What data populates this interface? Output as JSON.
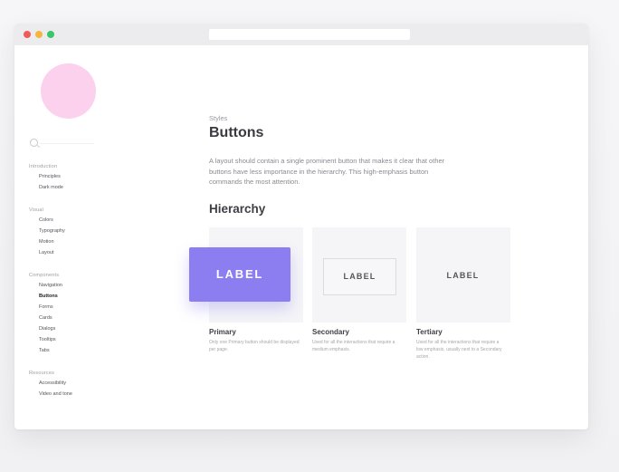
{
  "browser": {
    "address": ""
  },
  "sidebar": {
    "sections": [
      {
        "heading": "Introduction",
        "items": [
          "Principles",
          "Dark mode"
        ]
      },
      {
        "heading": "Visual",
        "items": [
          "Colors",
          "Typography",
          "Motion",
          "Layout"
        ]
      },
      {
        "heading": "Components",
        "items": [
          "Navigation",
          "Buttons",
          "Forms",
          "Cards",
          "Dialogs",
          "Tooltips",
          "Tabs"
        ]
      },
      {
        "heading": "Resources",
        "items": [
          "Accessibility",
          "Video and tone"
        ]
      }
    ],
    "active_item": "Buttons"
  },
  "main": {
    "eyebrow": "Styles",
    "title": "Buttons",
    "intro": "A layout should contain a single prominent button that makes it clear that other buttons have less importance in the hierarchy. This high-emphasis button commands the most attention.",
    "section_title": "Hierarchy",
    "cards": [
      {
        "button_label": "LABEL",
        "title": "Primary",
        "description": "Only one Primary button should be displayed per page."
      },
      {
        "button_label": "LABEL",
        "title": "Secondary",
        "description": "Used for all the interactions that require a medium emphasis."
      },
      {
        "button_label": "LABEL",
        "title": "Tertiary",
        "description": "Used for all the interactions that require a low emphasis, usually next to a Secondary action."
      }
    ]
  },
  "colors": {
    "primary_button": "#8c7df0",
    "logo_circle": "#fbd1ee",
    "window_close": "#ef5b5b",
    "window_minimize": "#f5b63e",
    "window_zoom": "#3cc56a"
  },
  "icons": {
    "search": "search-icon"
  }
}
